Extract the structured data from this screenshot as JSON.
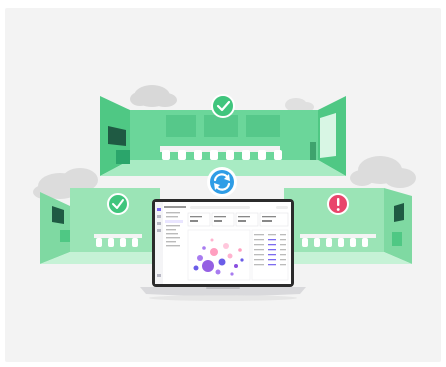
{
  "illustration": {
    "rooms": [
      {
        "id": "top-room",
        "status": "ok",
        "status_icon": "checkmark-icon",
        "color": "#5fcf8f"
      },
      {
        "id": "left-room",
        "status": "ok",
        "status_icon": "checkmark-icon",
        "color": "#8fe0ab"
      },
      {
        "id": "right-room",
        "status": "alert",
        "status_icon": "exclamation-icon",
        "color": "#8fe0ab"
      }
    ],
    "sync_icon": "sync-icon",
    "colors": {
      "room_dark": "#3fbf7a",
      "room_mid": "#66d592",
      "room_light": "#a6e9bf",
      "ok_badge": "#3fc37b",
      "alert_badge": "#e8446a",
      "sync_badge": "#2f9de6",
      "cloud": "#d6d6d6",
      "background": "#f3f3f3"
    },
    "laptop": {
      "dashboard_icon": "dashboard-screen",
      "chart_icon": "bubble-chart-icon"
    }
  }
}
